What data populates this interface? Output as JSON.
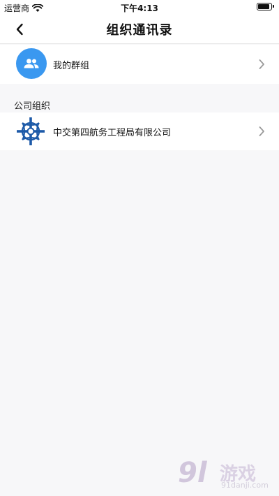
{
  "status_bar": {
    "carrier": "运营商",
    "time": "下午4:13",
    "battery_level": 0.95,
    "icons": [
      "wifi-icon",
      "battery-icon"
    ]
  },
  "nav": {
    "title": "组织通讯录",
    "back_icon": "back-chevron-icon"
  },
  "my_groups": {
    "label": "我的群组",
    "icon": "people-group-icon",
    "icon_bg": "#3a98f0"
  },
  "company_section": {
    "header": "公司组织",
    "items": [
      {
        "name": "中交第四航务工程局有限公司",
        "logo": "company-logo"
      }
    ]
  },
  "watermark": {
    "big": "9l",
    "game": "游戏",
    "url": "91danji.com"
  },
  "colors": {
    "accent": "#3a98f0",
    "logo_blue": "#1d5aa8",
    "background": "#f7f7f9"
  }
}
